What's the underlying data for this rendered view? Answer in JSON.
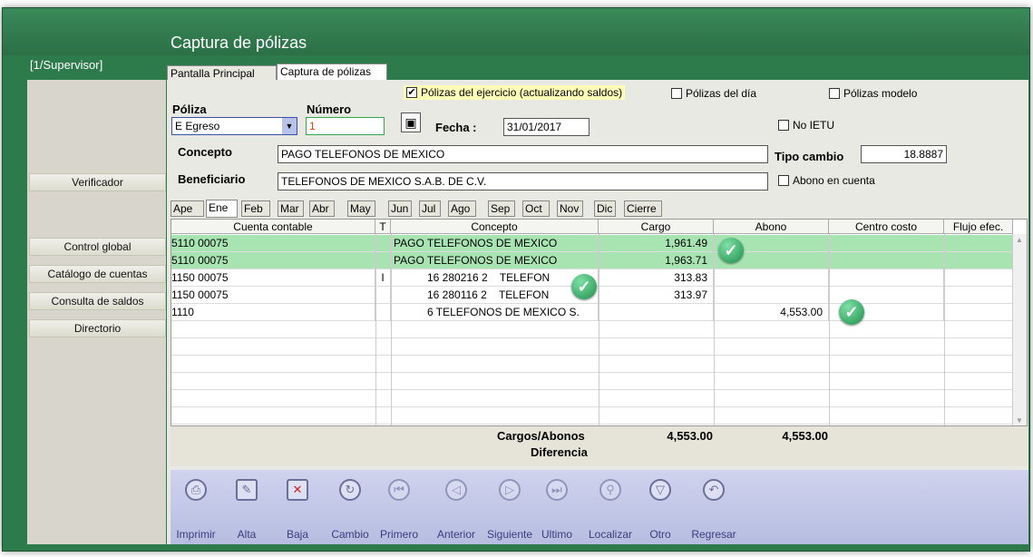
{
  "app": {
    "title": "Captura de pólizas",
    "user": "[1/Supervisor]"
  },
  "tabs": [
    {
      "label": "Pantalla Principal"
    },
    {
      "label": "Captura de pólizas"
    }
  ],
  "sidebar": {
    "items": [
      {
        "label": "Verificador"
      },
      {
        "label": "Control global"
      },
      {
        "label": "Catálogo de cuentas"
      },
      {
        "label": "Consulta de saldos"
      },
      {
        "label": "Directorio"
      }
    ]
  },
  "options": {
    "polizas_ejercicio": {
      "label": "Pólizas del ejercicio (actualizando saldos)",
      "checked": true
    },
    "polizas_dia": {
      "label": "Pólizas del día",
      "checked": false
    },
    "polizas_modelo": {
      "label": "Pólizas modelo",
      "checked": false
    },
    "no_ietu": {
      "label": "No IETU",
      "checked": false
    },
    "abono_cuenta": {
      "label": "Abono en cuenta",
      "checked": false
    }
  },
  "form": {
    "poliza_label": "Póliza",
    "poliza_value": "E Egreso",
    "numero_label": "Número",
    "numero_value": "1",
    "fecha_label": "Fecha :",
    "fecha_value": "31/01/2017",
    "concepto_label": "Concepto",
    "concepto_value": "PAGO TELEFONOS DE MEXICO",
    "tipo_cambio_label": "Tipo cambio",
    "tipo_cambio_value": "18.8887",
    "beneficiario_label": "Beneficiario",
    "beneficiario_value": "TELEFONOS DE MEXICO S.A.B. DE C.V."
  },
  "month_tabs": [
    "Ape",
    "Ene",
    "Feb",
    "Mar",
    "Abr",
    "May",
    "Jun",
    "Jul",
    "Ago",
    "Sep",
    "Oct",
    "Nov",
    "Dic",
    "Cierre"
  ],
  "grid": {
    "columns": [
      "Cuenta contable",
      "T",
      "Concepto",
      "Cargo",
      "Abono",
      "Centro costo",
      "Flujo efec."
    ],
    "rows": [
      {
        "cuenta": "5110 00075",
        "t": "",
        "concepto": "PAGO TELEFONOS DE MEXICO",
        "cargo": "1,961.49",
        "abono": "",
        "centro": "",
        "flujo": ""
      },
      {
        "cuenta": "5110 00075",
        "t": "",
        "concepto": "PAGO TELEFONOS DE MEXICO",
        "cargo": "1,963.71",
        "abono": "",
        "centro": "",
        "flujo": ""
      },
      {
        "cuenta": "1150 00075",
        "t": "I",
        "concepto": "16 280216 2    TELEFON",
        "cargo": "313.83",
        "abono": "",
        "centro": "",
        "flujo": ""
      },
      {
        "cuenta": "1150 00075",
        "t": "",
        "concepto": "16 280116 2    TELEFON",
        "cargo": "313.97",
        "abono": "",
        "centro": "",
        "flujo": ""
      },
      {
        "cuenta": "1110",
        "t": "",
        "concepto": "6 TELEFONOS DE MEXICO S.",
        "cargo": "",
        "abono": "4,553.00",
        "centro": "",
        "flujo": ""
      }
    ]
  },
  "totals": {
    "label": "Cargos/Abonos",
    "cargo": "4,553.00",
    "abono": "4,553.00",
    "diferencia_label": "Diferencia"
  },
  "toolbar": [
    {
      "label": "Imprimir",
      "icon": "printer-icon"
    },
    {
      "label": "Alta",
      "icon": "new-document-icon"
    },
    {
      "label": "Baja",
      "icon": "delete-icon"
    },
    {
      "label": "Cambio",
      "icon": "refresh-icon"
    },
    {
      "label": "Primero",
      "icon": "first-icon"
    },
    {
      "label": "Anterior",
      "icon": "previous-icon"
    },
    {
      "label": "Siguiente",
      "icon": "next-icon"
    },
    {
      "label": "Ultimo",
      "icon": "last-icon"
    },
    {
      "label": "Localizar",
      "icon": "search-icon"
    },
    {
      "label": "Otro",
      "icon": "other-icon"
    },
    {
      "label": "Regresar",
      "icon": "return-icon"
    }
  ]
}
